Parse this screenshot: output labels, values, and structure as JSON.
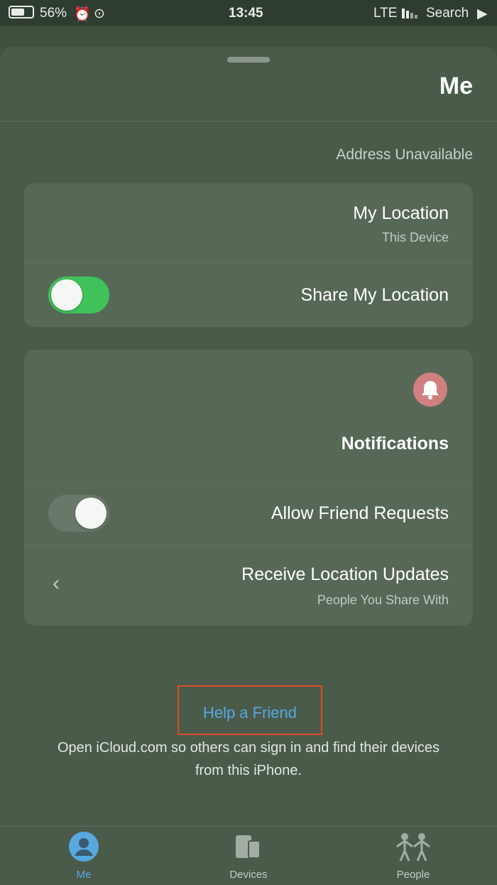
{
  "status_bar": {
    "battery": "56%",
    "time": "13:45",
    "network": "LTE",
    "back_label": "Search"
  },
  "header": {
    "title": "Me"
  },
  "address": "Address Unavailable",
  "location_card": {
    "my_location_title": "My Location",
    "my_location_sub": "This Device",
    "share_label": "Share My Location",
    "share_on": true
  },
  "notifications_card": {
    "title": "Notifications",
    "allow_label": "Allow Friend Requests",
    "allow_on": false,
    "updates_title": "Receive Location Updates",
    "updates_sub": "People You Share With"
  },
  "help": {
    "link": "Help a Friend",
    "description": "Open iCloud.com so others can sign in and find their devices from this iPhone."
  },
  "tabs": [
    {
      "label": "Me",
      "icon": "person-circle-icon",
      "active": true
    },
    {
      "label": "Devices",
      "icon": "devices-icon",
      "active": false
    },
    {
      "label": "People",
      "icon": "people-icon",
      "active": false
    }
  ],
  "colors": {
    "accent": "#58a8e0",
    "toggle_on": "#3fc25a",
    "highlight_box": "#e04a2a"
  }
}
